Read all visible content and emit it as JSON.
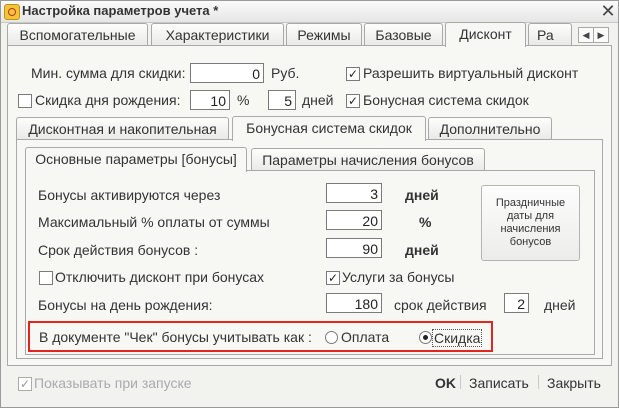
{
  "window": {
    "title": "Настройка параметров учета *"
  },
  "main_tabs": [
    "Вспомогательные",
    "Характеристики",
    "Режимы",
    "Базовые",
    "Дисконт",
    "Ра"
  ],
  "top": {
    "min_sum_label": "Мин. сумма для скидки:",
    "min_sum_value": "0",
    "currency": "Руб.",
    "allow_virtual_label": "Разрешить виртуальный дисконт",
    "birthday_discount_label": "Скидка дня рождения:",
    "birthday_percent_value": "10",
    "percent_sign": "%",
    "birthday_days_value": "5",
    "days_label": "дней",
    "bonus_system_label": "Бонусная система скидок"
  },
  "sub_tabs": [
    "Дисконтная и накопительная",
    "Бонусная система скидок",
    "Дополнительно"
  ],
  "inner_tabs": [
    "Основные параметры [бонусы]",
    "Параметры начисления бонусов"
  ],
  "bonus": {
    "activate_label": "Бонусы активируются через",
    "activate_value": "3",
    "activate_unit": "дней",
    "max_pay_label": "Максимальный % оплаты от суммы",
    "max_pay_value": "20",
    "max_pay_unit": "%",
    "validity_label": "Срок действия бонусов :",
    "validity_value": "90",
    "validity_unit": "дней",
    "holiday_button": "Праздничные даты для начисления бонусов",
    "disable_discount_label": "Отключить дисконт при бонусах",
    "services_label": "Услуги за бонусы",
    "birthday_bonus_label": "Бонусы на день рождения:",
    "birthday_bonus_value": "180",
    "validity_period_label": "срок действия",
    "validity_period_value": "2",
    "validity_period_unit": "дней",
    "receipt_label": "В документе \"Чек\" бонусы учитывать как :",
    "option_payment": "Оплата",
    "option_discount": "Скидка"
  },
  "footer": {
    "show_on_start": "Показывать при запуске",
    "ok": "OK",
    "save": "Записать",
    "close": "Закрыть"
  },
  "colors": {
    "highlight_box": "#e0261f"
  }
}
